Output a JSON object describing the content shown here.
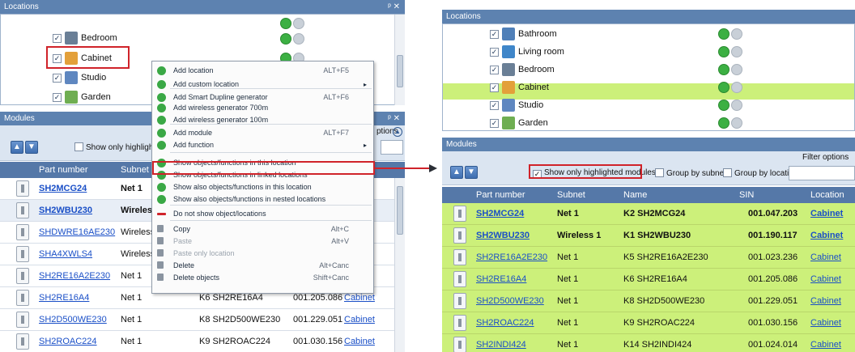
{
  "left": {
    "locations_title": "Locations",
    "pin_close": "ᵖ ✕",
    "tree": [
      {
        "label": "Bedroom"
      },
      {
        "label": "Cabinet"
      },
      {
        "label": "Studio"
      },
      {
        "label": "Garden"
      }
    ],
    "modules_title": "Modules",
    "filter_options_label": "ptions",
    "show_only_highlighted": "Show only highlighted",
    "columns": {
      "part": "Part number",
      "subnet": "Subnet"
    },
    "rows": [
      {
        "part": "SH2MCG24",
        "subnet": "Net 1",
        "name": "",
        "sin": "",
        "loc": ""
      },
      {
        "part": "SH2WBU230",
        "subnet": "Wireless",
        "name": "",
        "sin": "",
        "loc": ""
      },
      {
        "part": "SHDWRE16AE230",
        "subnet": "Wireless",
        "name": "",
        "sin": "",
        "loc": ""
      },
      {
        "part": "SHA4XWLS4",
        "subnet": "Wireless",
        "name": "",
        "sin": "",
        "loc": ""
      },
      {
        "part": "SH2RE16A2E230",
        "subnet": "Net 1",
        "name": "",
        "sin": "",
        "loc": ""
      },
      {
        "part": "SH2RE16A4",
        "subnet": "Net 1",
        "name": "K6 SH2RE16A4",
        "sin": "001.205.086",
        "loc": "Cabinet"
      },
      {
        "part": "SH2D500WE230",
        "subnet": "Net 1",
        "name": "K8 SH2D500WE230",
        "sin": "001.229.051",
        "loc": "Cabinet"
      },
      {
        "part": "SH2ROAC224",
        "subnet": "Net 1",
        "name": "K9 SH2ROAC224",
        "sin": "001.030.156",
        "loc": "Cabinet"
      }
    ]
  },
  "menu": [
    {
      "label": "Add location",
      "sc": "ALT+F5",
      "sub": "",
      "icon": "green"
    },
    {
      "label": "Add custom location",
      "sc": "",
      "sub": "▸",
      "icon": "green"
    },
    {
      "label": "Add Smart Dupline generator",
      "sc": "ALT+F6",
      "sub": "",
      "icon": "green"
    },
    {
      "label": "Add wireless generator 700m",
      "sc": "",
      "sub": "",
      "icon": "green"
    },
    {
      "label": "Add wireless generator 100m",
      "sc": "",
      "sub": "",
      "icon": "green"
    },
    {
      "label": "Add module",
      "sc": "ALT+F7",
      "sub": "",
      "icon": "green"
    },
    {
      "label": "Add function",
      "sc": "",
      "sub": "▸",
      "icon": "green"
    },
    {
      "label": "Show objects/functions in this location",
      "sc": "",
      "sub": "",
      "icon": "green"
    },
    {
      "label": "Show objects/functions in linked locations",
      "sc": "",
      "sub": "",
      "icon": "green"
    },
    {
      "label": "Show also objects/functions in this location",
      "sc": "",
      "sub": "",
      "icon": "green"
    },
    {
      "label": "Show also objects/functions in nested locations",
      "sc": "",
      "sub": "",
      "icon": "green"
    },
    {
      "label": "Do not show object/locations",
      "sc": "",
      "sub": "",
      "icon": "red"
    },
    {
      "label": "Copy",
      "sc": "Alt+C",
      "sub": "",
      "icon": "none"
    },
    {
      "label": "Paste",
      "sc": "Alt+V",
      "sub": "",
      "icon": "none"
    },
    {
      "label": "Paste only location",
      "sc": "",
      "sub": "",
      "icon": "none"
    },
    {
      "label": "Delete",
      "sc": "Alt+Canc",
      "sub": "",
      "icon": "none"
    },
    {
      "label": "Delete objects",
      "sc": "Shift+Canc",
      "sub": "",
      "icon": "none"
    }
  ],
  "right": {
    "locations_title": "Locations",
    "tree": [
      {
        "label": "Bathroom"
      },
      {
        "label": "Living room"
      },
      {
        "label": "Bedroom"
      },
      {
        "label": "Cabinet"
      },
      {
        "label": "Studio"
      },
      {
        "label": "Garden"
      }
    ],
    "modules_title": "Modules",
    "filter_options": "Filter options",
    "show_only_highlighted": "Show only highlighted modules",
    "group_subnet": "Group by subnet",
    "group_location": "Group by location",
    "columns": {
      "part": "Part number",
      "subnet": "Subnet",
      "name": "Name",
      "sin": "SIN",
      "loc": "Location"
    },
    "rows": [
      {
        "part": "SH2MCG24",
        "subnet": "Net 1",
        "name": "K2 SH2MCG24",
        "sin": "001.047.203",
        "loc": "Cabinet"
      },
      {
        "part": "SH2WBU230",
        "subnet": "Wireless 1",
        "name": "K1 SH2WBU230",
        "sin": "001.190.117",
        "loc": "Cabinet"
      },
      {
        "part": "SH2RE16A2E230",
        "subnet": "Net 1",
        "name": "K5 SH2RE16A2E230",
        "sin": "001.023.236",
        "loc": "Cabinet"
      },
      {
        "part": "SH2RE16A4",
        "subnet": "Net 1",
        "name": "K6 SH2RE16A4",
        "sin": "001.205.086",
        "loc": "Cabinet"
      },
      {
        "part": "SH2D500WE230",
        "subnet": "Net 1",
        "name": "K8 SH2D500WE230",
        "sin": "001.229.051",
        "loc": "Cabinet"
      },
      {
        "part": "SH2ROAC224",
        "subnet": "Net 1",
        "name": "K9 SH2ROAC224",
        "sin": "001.030.156",
        "loc": "Cabinet"
      },
      {
        "part": "SH2INDI424",
        "subnet": "Net 1",
        "name": "K14 SH2INDI424",
        "sin": "001.024.014",
        "loc": "Cabinet"
      }
    ]
  },
  "colors": {
    "highlight": "#ccf07a",
    "header": "#5d82b0",
    "red": "#d0232a",
    "link": "#1a4fc7"
  }
}
